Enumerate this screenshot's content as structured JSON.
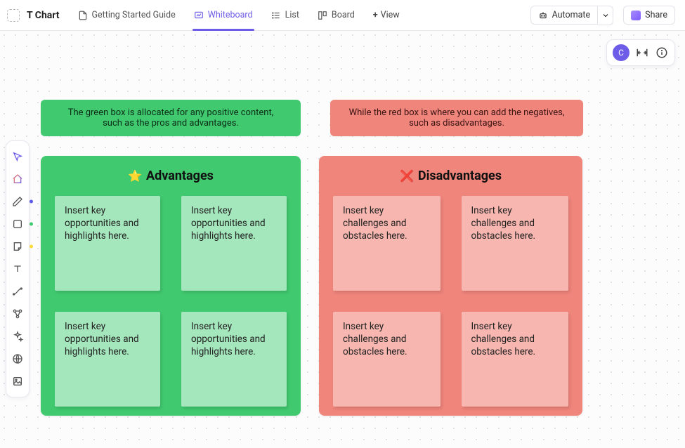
{
  "header": {
    "title": "T Chart",
    "tabs": [
      {
        "label": "Getting Started Guide",
        "icon": "doc-icon"
      },
      {
        "label": "Whiteboard",
        "icon": "whiteboard-icon"
      },
      {
        "label": "List",
        "icon": "list-icon"
      },
      {
        "label": "Board",
        "icon": "board-icon"
      }
    ],
    "add_view_label": "View",
    "automate_label": "Automate",
    "share_label": "Share"
  },
  "corner": {
    "avatar_initial": "C"
  },
  "banners": {
    "green": "The green box is allocated for any positive content, such as the pros and advantages.",
    "red": "While the red box is where you can add the negatives, such as disadvantages."
  },
  "columns": {
    "advantages": {
      "emoji": "⭐",
      "title": "Advantages",
      "notes": [
        "Insert key opportunities and highlights here.",
        "Insert key opportunities and highlights here.",
        "Insert key opportunities and highlights here.",
        "Insert key opportunities and highlights here."
      ]
    },
    "disadvantages": {
      "emoji": "❌",
      "title": "Disadvantages",
      "notes": [
        "Insert key challenges and obstacles here.",
        "Insert key challenges and obstacles here.",
        "Insert key challenges and obstacles here.",
        "Insert key challenges and obstacles here."
      ]
    }
  },
  "colors": {
    "accent": "#6c5ce7",
    "green": "#41c96f",
    "green_note": "#a5e7bd",
    "red": "#f0857c",
    "red_note": "#f7b6af"
  }
}
